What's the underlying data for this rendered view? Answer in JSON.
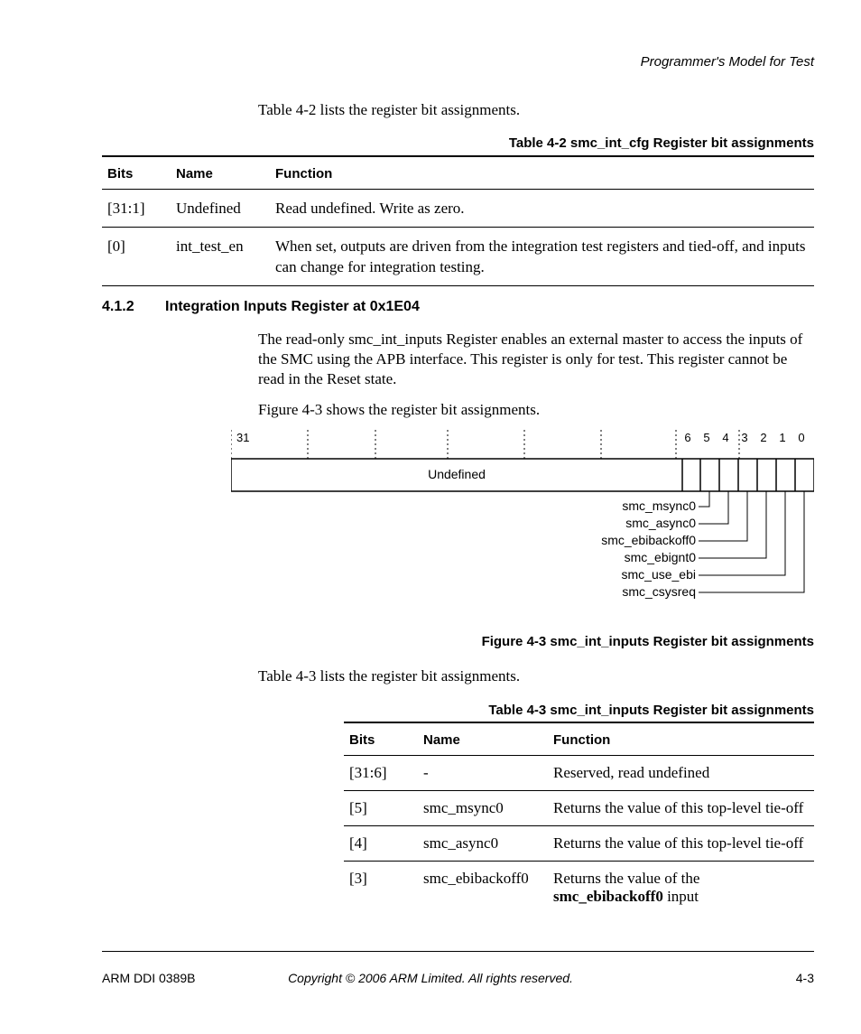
{
  "header": {
    "right": "Programmer's Model for Test"
  },
  "intro1": "Table 4-2 lists the register bit assignments.",
  "table1": {
    "caption": "Table 4-2 smc_int_cfg Register bit assignments",
    "headers": {
      "bits": "Bits",
      "name": "Name",
      "func": "Function"
    },
    "rows": [
      {
        "bits": "[31:1]",
        "name": "Undefined",
        "func": "Read undefined. Write as zero."
      },
      {
        "bits": "[0]",
        "name": "int_test_en",
        "func": "When set, outputs are driven from the integration test registers and tied-off, and inputs can change for integration testing."
      }
    ]
  },
  "section": {
    "num": "4.1.2",
    "title": "Integration Inputs Register at 0x1E04"
  },
  "para1": "The read-only smc_int_inputs Register enables an external master to access the inputs of the SMC using the APB interface. This register is only for test. This register cannot be read in the Reset state.",
  "para2": "Figure 4-3 shows the register bit assignments.",
  "figure": {
    "bit_left": "31",
    "bits_right": [
      "6",
      "5",
      "4",
      "3",
      "2",
      "1",
      "0"
    ],
    "undefined": "Undefined",
    "signals": [
      "smc_msync0",
      "smc_async0",
      "smc_ebibackoff0",
      "smc_ebignt0",
      "smc_use_ebi",
      "smc_csysreq"
    ],
    "caption": "Figure 4-3 smc_int_inputs Register bit assignments"
  },
  "para3": "Table 4-3 lists the register bit assignments.",
  "table2": {
    "caption": "Table 4-3 smc_int_inputs Register bit assignments",
    "headers": {
      "bits": "Bits",
      "name": "Name",
      "func": "Function"
    },
    "rows": [
      {
        "bits": "[31:6]",
        "name": "-",
        "func_plain": "Reserved, read undefined"
      },
      {
        "bits": "[5]",
        "name": "smc_msync0",
        "func_plain": "Returns the value of this top-level tie-off"
      },
      {
        "bits": "[4]",
        "name": "smc_async0",
        "func_plain": "Returns the value of this top-level tie-off"
      },
      {
        "bits": "[3]",
        "name": "smc_ebibackoff0",
        "func_pre": "Returns the value of the ",
        "func_bold": "smc_ebibackoff0",
        "func_post": " input"
      }
    ]
  },
  "footer": {
    "left": "ARM DDI 0389B",
    "center": "Copyright © 2006 ARM Limited. All rights reserved.",
    "right": "4-3"
  }
}
